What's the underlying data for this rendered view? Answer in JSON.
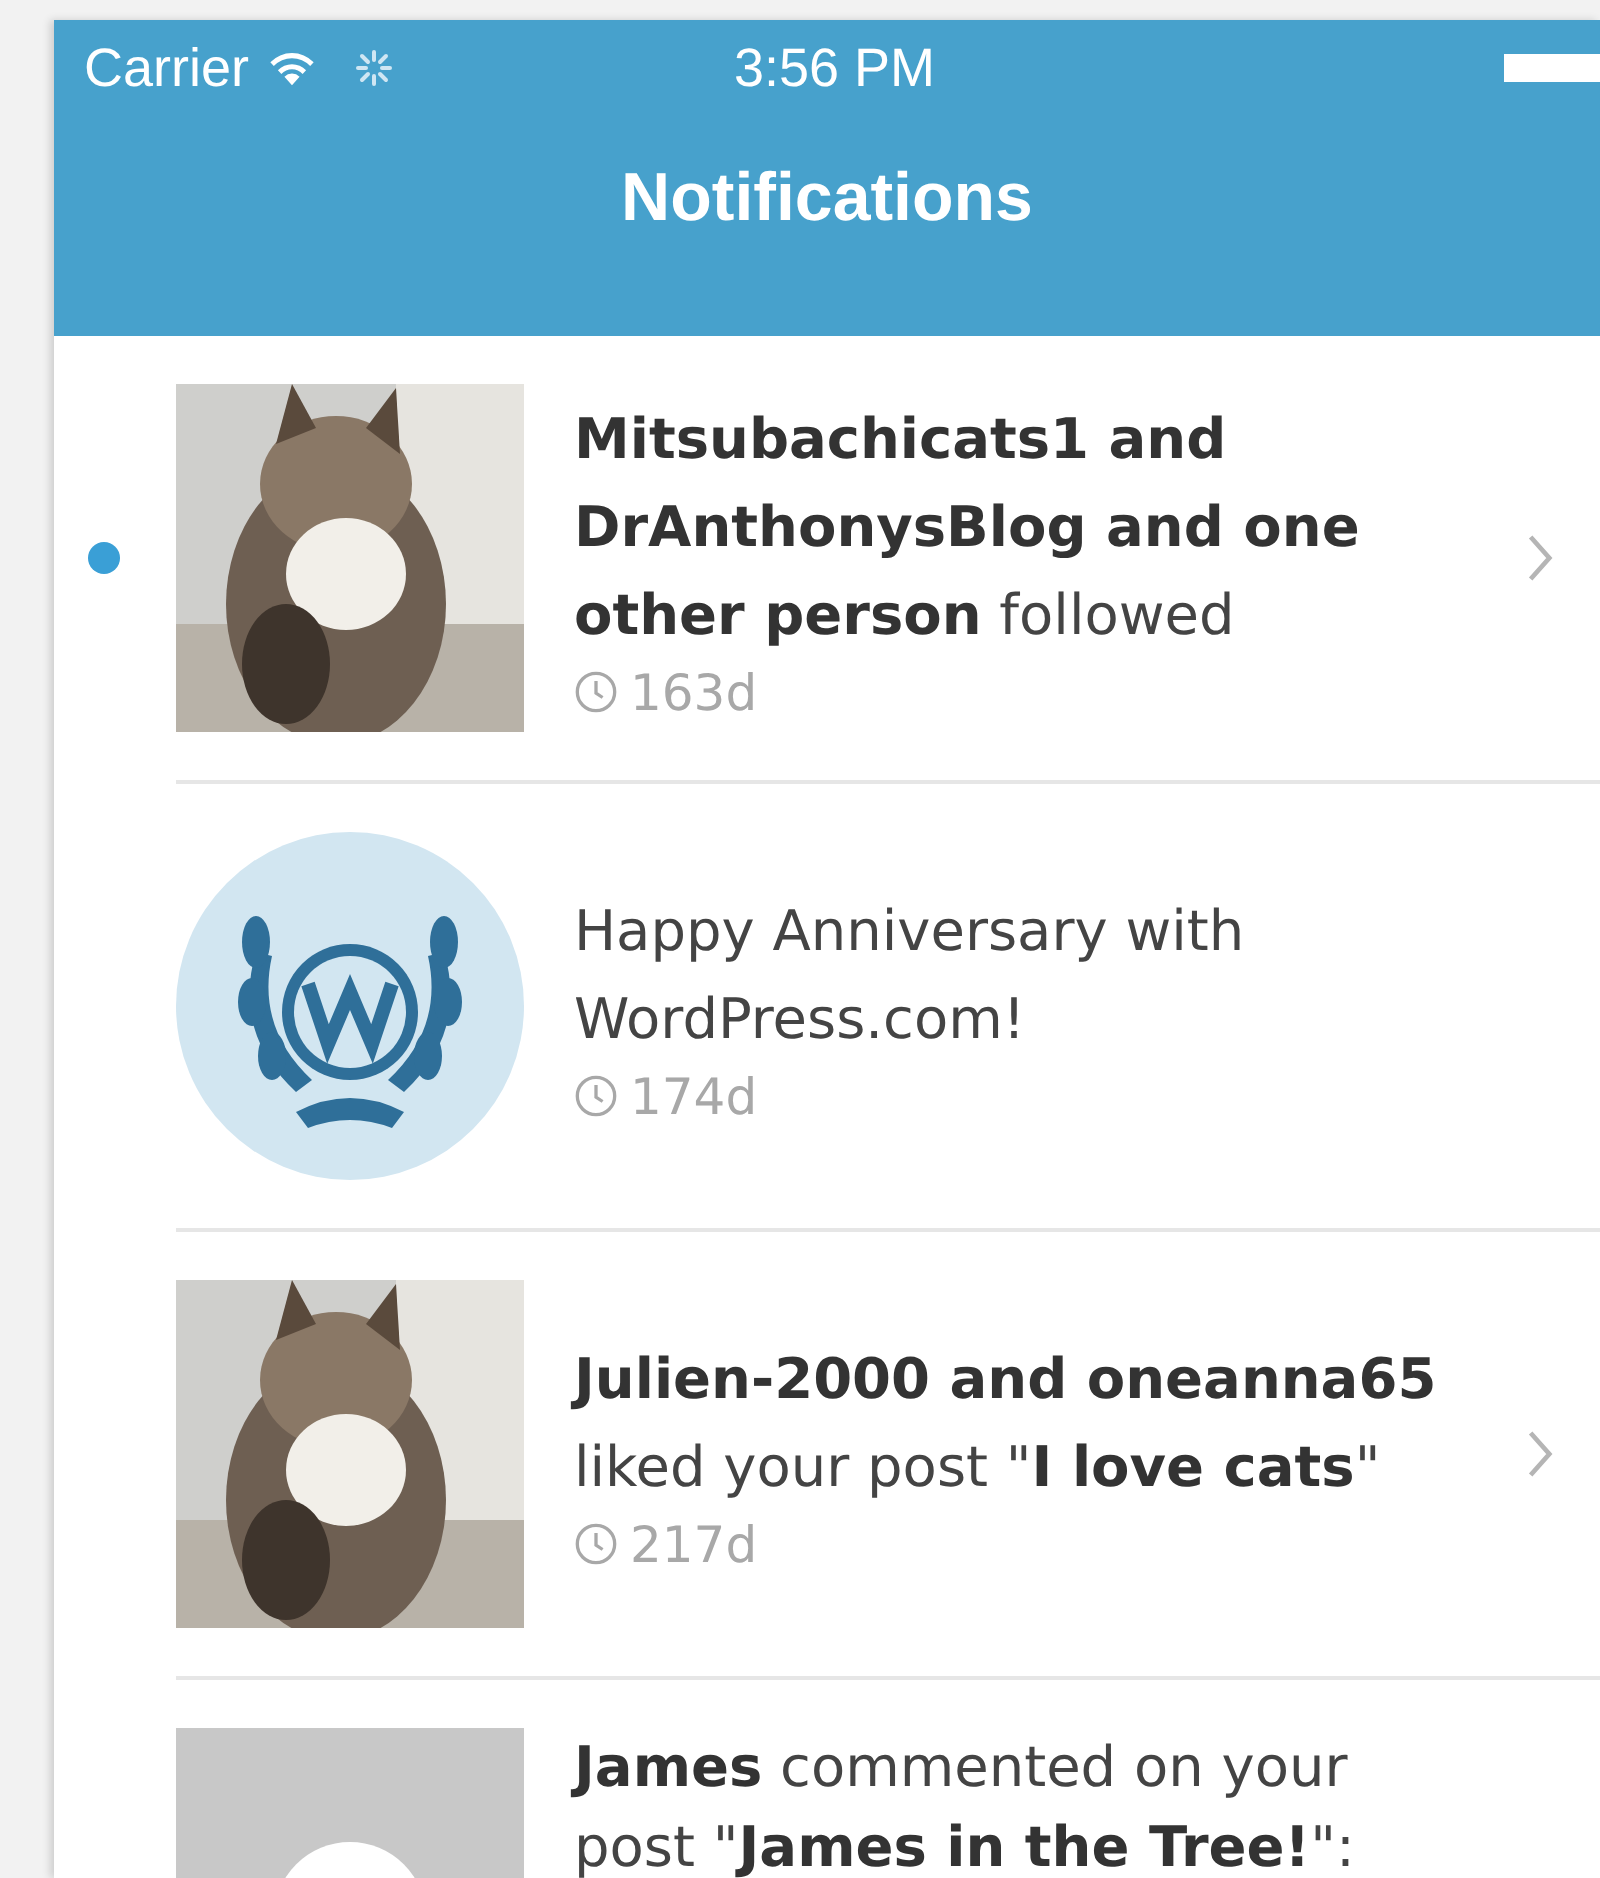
{
  "status_bar": {
    "carrier": "Carrier",
    "time": "3:56 PM"
  },
  "nav": {
    "title": "Notifications"
  },
  "notifications": [
    {
      "kind": "picture",
      "message": "**Mitsubachicats1 and DrAnthonysBlog and one other person** followed",
      "age": "163d",
      "unread": true,
      "chevron": true
    },
    {
      "kind": "anniversary",
      "message": "Happy Anniversary with WordPress.com!",
      "age": "174d",
      "unread": false,
      "chevron": false
    },
    {
      "kind": "picture",
      "message": "**Julien-2000 and oneanna65** liked your post \"**I love cats**\"",
      "age": "217d",
      "unread": false,
      "chevron": true
    },
    {
      "kind": "placeholder",
      "message": "**James** commented on your post \"**James in the Tree!**\":",
      "unread": false,
      "chevron": false
    }
  ]
}
